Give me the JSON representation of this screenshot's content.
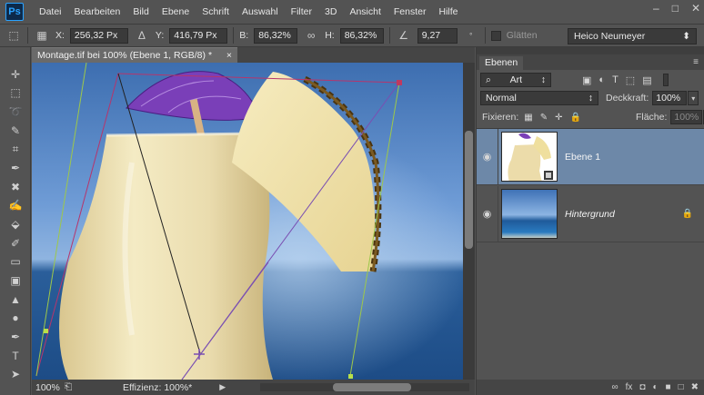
{
  "app": {
    "logo": "Ps"
  },
  "menu": [
    "Datei",
    "Bearbeiten",
    "Bild",
    "Ebene",
    "Schrift",
    "Auswahl",
    "Filter",
    "3D",
    "Ansicht",
    "Fenster",
    "Hilfe"
  ],
  "window_buttons": {
    "minimize": "–",
    "maximize": "□",
    "close": "✕"
  },
  "options": {
    "x_label": "X:",
    "x_value": "256,32 Px",
    "y_label": "Y:",
    "y_value": "416,79 Px",
    "b_label": "B:",
    "b_value": "86,32%",
    "h_label": "H:",
    "h_value": "86,32%",
    "angle_value": "9,27",
    "smooth_label": "Glätten",
    "workspace": "Heico Neumeyer"
  },
  "tools": [
    "move-tool",
    "marquee-tool",
    "lasso-tool",
    "quick-selection-tool",
    "crop-tool",
    "eyedropper-tool",
    "spot-healing-tool",
    "brush-tool",
    "clone-stamp-tool",
    "history-brush-tool",
    "eraser-tool",
    "gradient-tool",
    "blur-tool",
    "dodge-tool",
    "pen-tool",
    "type-tool",
    "path-selection-tool"
  ],
  "document": {
    "tab_title": "Montage.tif bei 100% (Ebene 1, RGB/8) *",
    "close": "×"
  },
  "status": {
    "zoom": "100%",
    "efficiency": "Effizienz: 100%*"
  },
  "layers_panel": {
    "tab": "Ebenen",
    "filter_kind": "Art",
    "blend_mode": "Normal",
    "opacity_label": "Deckkraft:",
    "opacity_value": "100%",
    "lock_label": "Fixieren:",
    "fill_label": "Fläche:",
    "fill_value": "100%",
    "layers": [
      {
        "name": "Ebene 1",
        "selected": true,
        "visible": true
      },
      {
        "name": "Hintergrund",
        "selected": false,
        "visible": true,
        "locked": true
      }
    ]
  }
}
